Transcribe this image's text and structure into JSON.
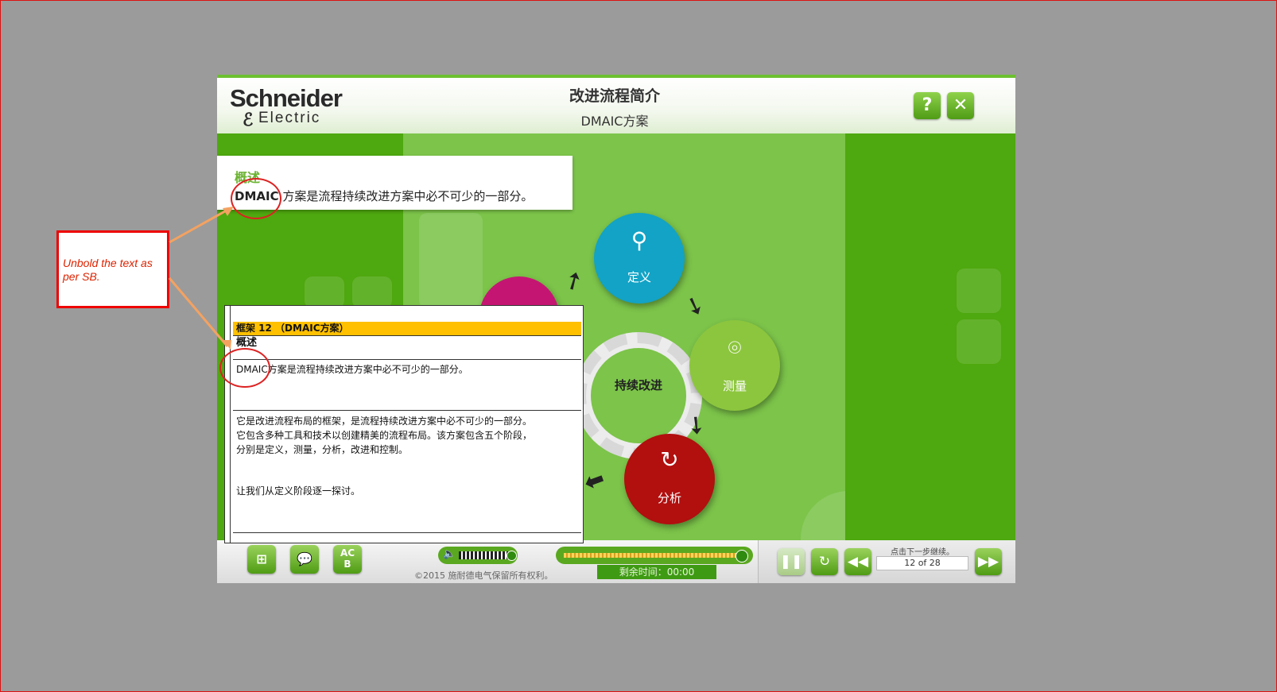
{
  "course": {
    "title": "改进流程简介",
    "subtitle": "DMAIC方案",
    "logo_top": "Schneider",
    "logo_bottom": "Electric",
    "help_label": "?",
    "close_label": "✕"
  },
  "overview": {
    "heading": "概述",
    "bold_term": "DMAIC",
    "text": "方案是流程持续改进方案中必不可少的一部分。"
  },
  "cycle": {
    "center": "持续改进",
    "phases": [
      {
        "label": "定义",
        "icon": "magnifier-icon",
        "color": "#12a3c6"
      },
      {
        "label": "测量",
        "icon": "location-pin-icon",
        "color": "#8cc63e"
      },
      {
        "label": "分析",
        "icon": "refresh-icon",
        "color": "#b20f0f"
      },
      {
        "label": "",
        "icon": "",
        "color": "#c51573"
      }
    ]
  },
  "doc": {
    "header": "框架 12 （DMAIC方案）",
    "subheader": "概述",
    "row1": "DMAIC方案是流程持续改进方案中必不可少的一部分。",
    "row2_line1": "它是改进流程布局的框架，是流程持续改进方案中必不可少的一部分。",
    "row2_line2": "它包含多种工具和技术以创建精美的流程布局。该方案包含五个阶段，",
    "row2_line3": "分别是定义，测量，分析，改进和控制。",
    "row2_line4": "让我们从定义阶段逐一探讨。"
  },
  "bottom": {
    "copyright": "©2015 施耐德电气保留所有权利。",
    "time_label": "剩余时间：00:00",
    "next_hint": "点击下一步继续。",
    "page": "12 of 28",
    "progress_fraction": 1.0
  },
  "annotation": {
    "text": "Unbold the text as per SB."
  }
}
